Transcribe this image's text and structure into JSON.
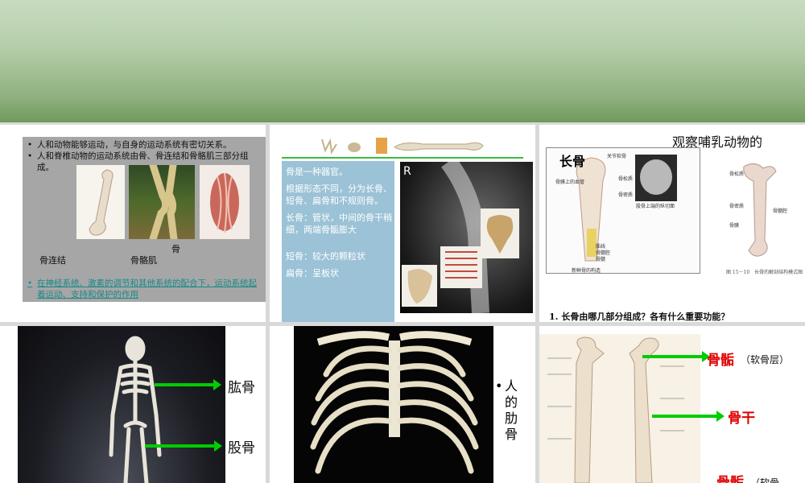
{
  "slide1": {
    "bullets": [
      "人和动物能够运动，与自身的运动系统有密切关系。",
      "人和脊椎动物的运动系统由骨、骨连结和骨骼肌三部分组成。"
    ],
    "photo_labels": {
      "bone": "骨",
      "joint": "骨连结",
      "muscle": "骨骼肌"
    },
    "bottom_note": "在神经系统、激素的调节和其他系统的配合下，运动系统起着运动、支持和保护的作用"
  },
  "slide2": {
    "paragraphs": [
      "骨是一种器官。",
      "根据形态不同，分为长骨、短骨、扁骨和不规则骨。",
      "长骨：管状，中间的骨干稍细，两端骨骺膨大",
      "短骨：较大的颗粒状",
      "扁骨：呈板状"
    ],
    "xray_marker": "R"
  },
  "slide3": {
    "title": "观察哺乳动物的",
    "diagram_title": "长骨",
    "diagram_labels": [
      "关节软骨",
      "骨膜上的血管",
      "骨松质",
      "骨密质",
      "骨髓",
      "新鲜骨的构造",
      "骺线",
      "骨髓腔",
      "股骨上端的纵切面"
    ],
    "side_labels": [
      "骨松质",
      "骨密质",
      "骨髓腔",
      "骨膜"
    ],
    "caption": "图 15－10　长骨的解剖结构模式图",
    "question": "1. 长骨由哪几部分组成？各有什么重要功能？"
  },
  "slide4": {
    "labels": [
      "肱骨",
      "股骨"
    ]
  },
  "slide5": {
    "side_text": "人的肋骨"
  },
  "slide6": {
    "top_label": "骨骺",
    "top_note": "（软骨层）",
    "mid_label": "骨干",
    "bottom_label": "骨骺",
    "bottom_note": "（软骨"
  }
}
